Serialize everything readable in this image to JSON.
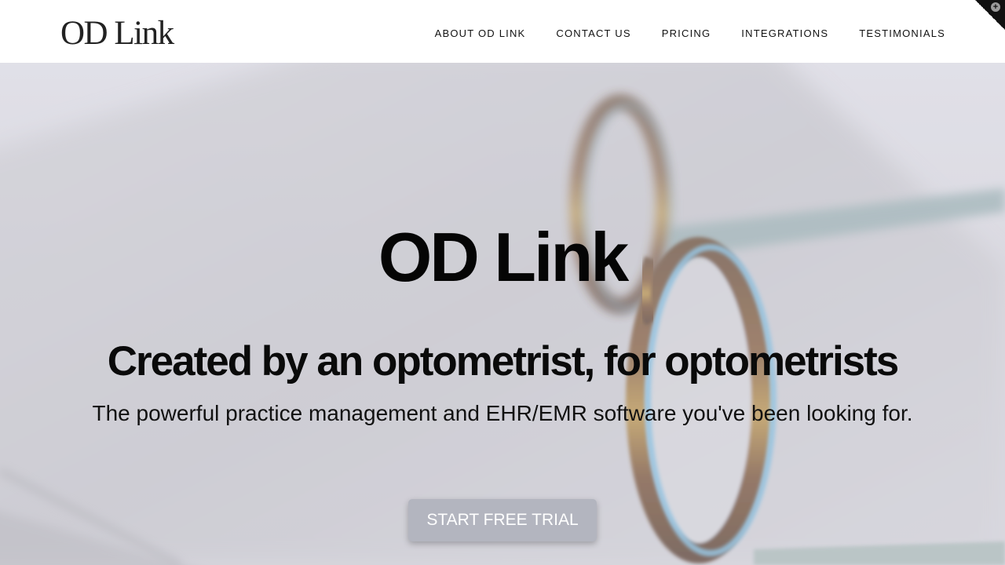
{
  "header": {
    "logo": "OD Link",
    "nav": [
      {
        "label": "ABOUT OD LINK"
      },
      {
        "label": "CONTACT US"
      },
      {
        "label": "PRICING"
      },
      {
        "label": "INTEGRATIONS"
      },
      {
        "label": "TESTIMONIALS"
      }
    ],
    "corner_icon": "plus-icon"
  },
  "hero": {
    "title": "OD Link",
    "subtitle": "Created by an optometrist, for optometrists",
    "description": "The powerful practice management and EHR/EMR software you've been looking for.",
    "cta_label": "START FREE TRIAL",
    "background_image": "eyeglasses-on-laptop-photo"
  },
  "colors": {
    "text": "#050505",
    "header_bg": "#ffffff",
    "cta_bg": "#b3b5bf",
    "cta_text": "#ffffff"
  }
}
